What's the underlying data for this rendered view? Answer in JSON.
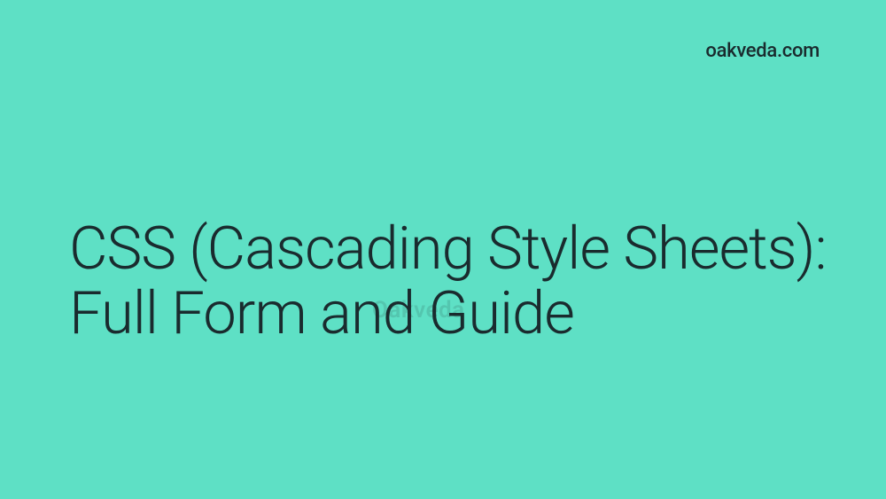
{
  "brand": "oakveda.com",
  "title": "CSS (Cascading Style Sheets): Full Form and Guide",
  "watermark": "Oakveda"
}
